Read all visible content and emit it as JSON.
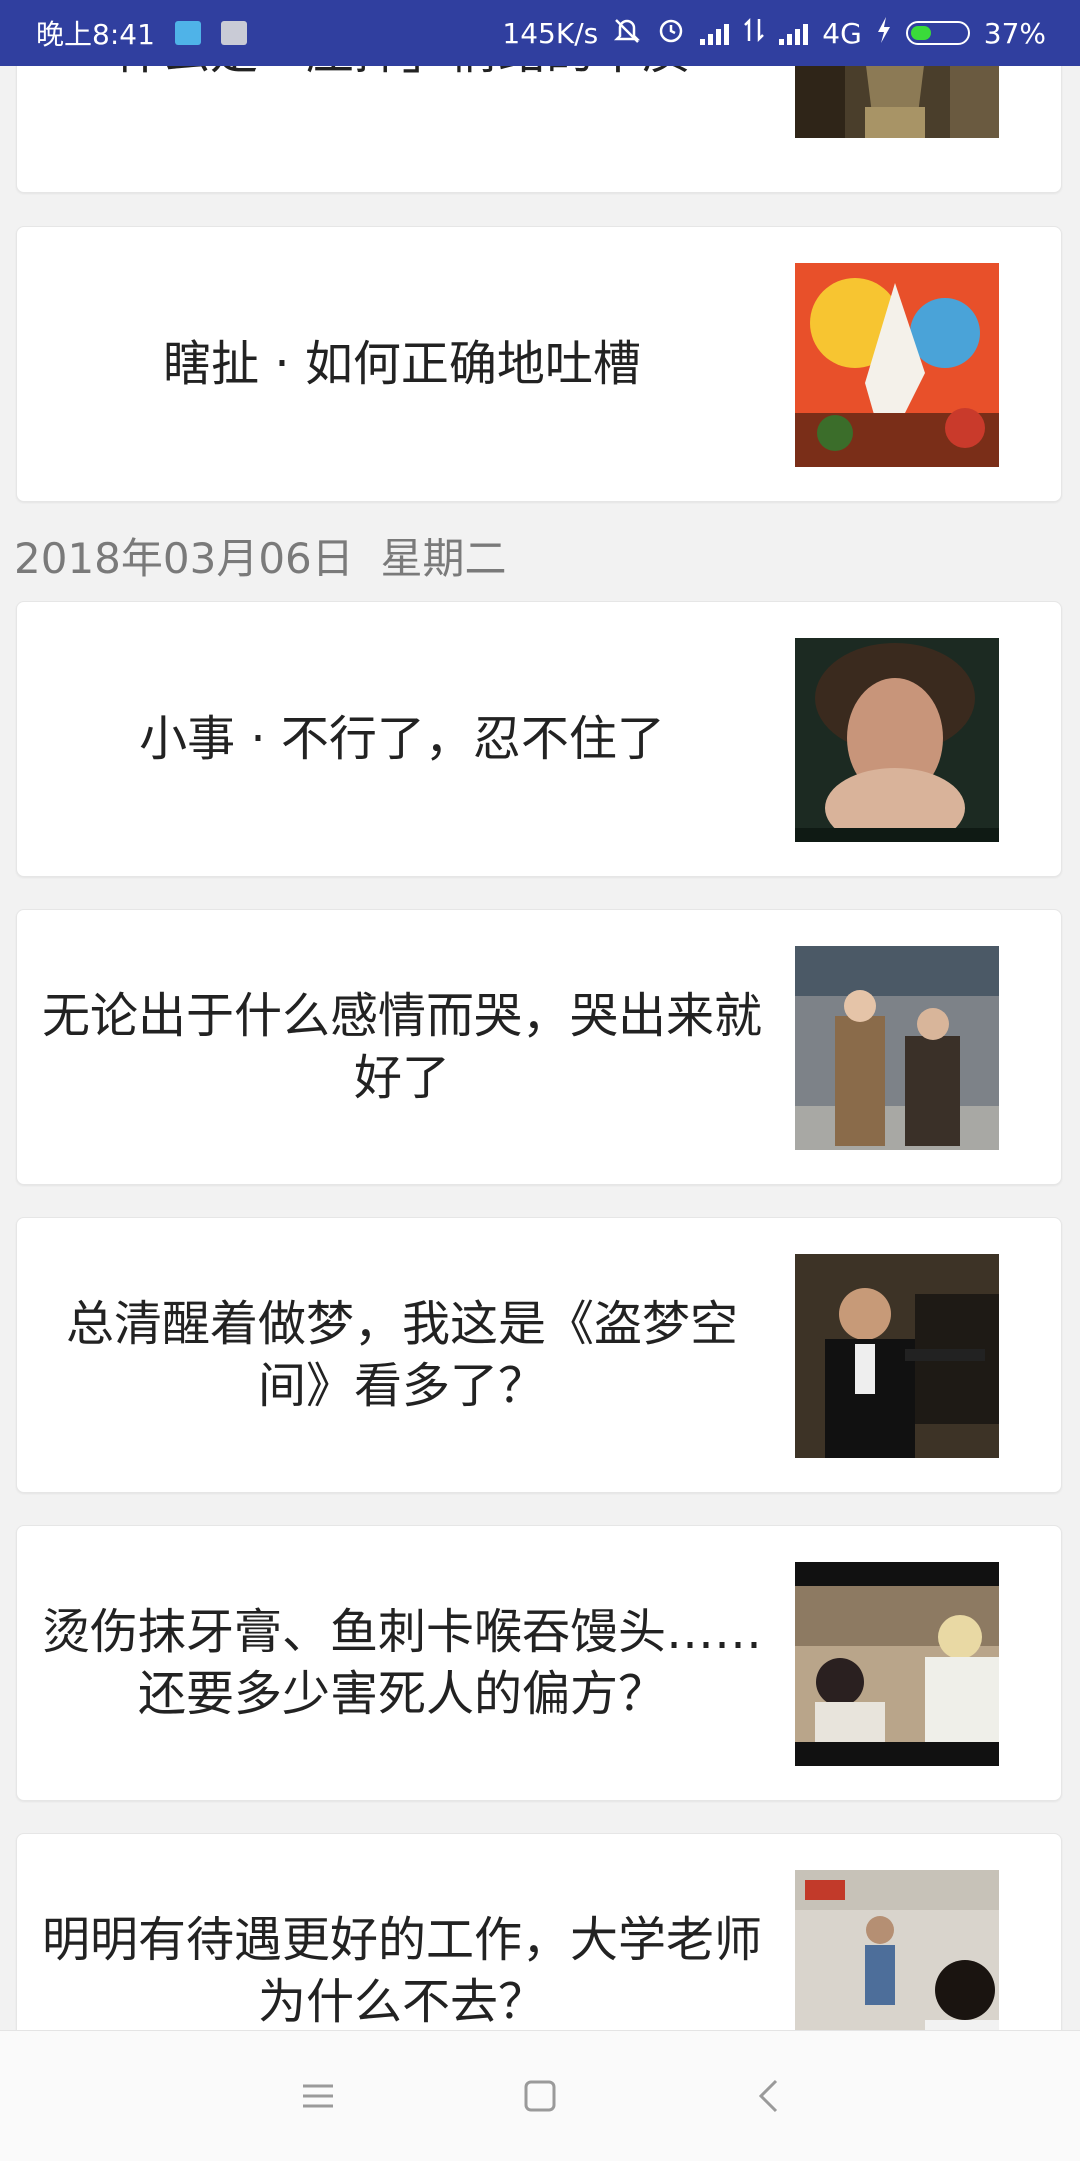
{
  "status_bar": {
    "time": "晚上8:41",
    "speed": "145K/s",
    "network": "4G",
    "battery": "37%",
    "battery_level": 0.37,
    "icons": [
      "notification-app-icon",
      "message-icon",
      "mute-icon",
      "alarm-icon",
      "signal-icon",
      "data-transfer-icon",
      "signal-icon",
      "charging-icon",
      "battery-icon"
    ]
  },
  "feed": {
    "top_cards": [
      {
        "title": "什么是「压抑」情绪的本质",
        "thumbnail": "corridor-photo"
      },
      {
        "title": "瞎扯 · 如何正确地吐槽",
        "thumbnail": "cartoon-illustration"
      }
    ],
    "date_header": "2018年03月06日  星期二",
    "cards": [
      {
        "title": "小事 · 不行了，忍不住了",
        "thumbnail": "woman-crying-photo"
      },
      {
        "title": "无论出于什么感情而哭，哭出来就好了",
        "thumbnail": "street-women-photo"
      },
      {
        "title": "总清醒着做梦，我这是《盗梦空间》看多了？",
        "thumbnail": "man-with-gun-photo"
      },
      {
        "title": "烫伤抹牙膏、鱼刺卡喉吞馒头……还要多少害死人的偏方？",
        "thumbnail": "movie-scene-photo"
      },
      {
        "title": "明明有待遇更好的工作，大学老师为什么不去？",
        "thumbnail": "classroom-photo"
      }
    ]
  },
  "nav_bar": {
    "icons": [
      "menu-icon",
      "home-icon",
      "back-icon"
    ]
  },
  "colors": {
    "status_bar": "#303f9f",
    "background": "#f2f2f2",
    "card": "#ffffff",
    "title_text": "#222222",
    "date_text": "#7a7a7a"
  }
}
